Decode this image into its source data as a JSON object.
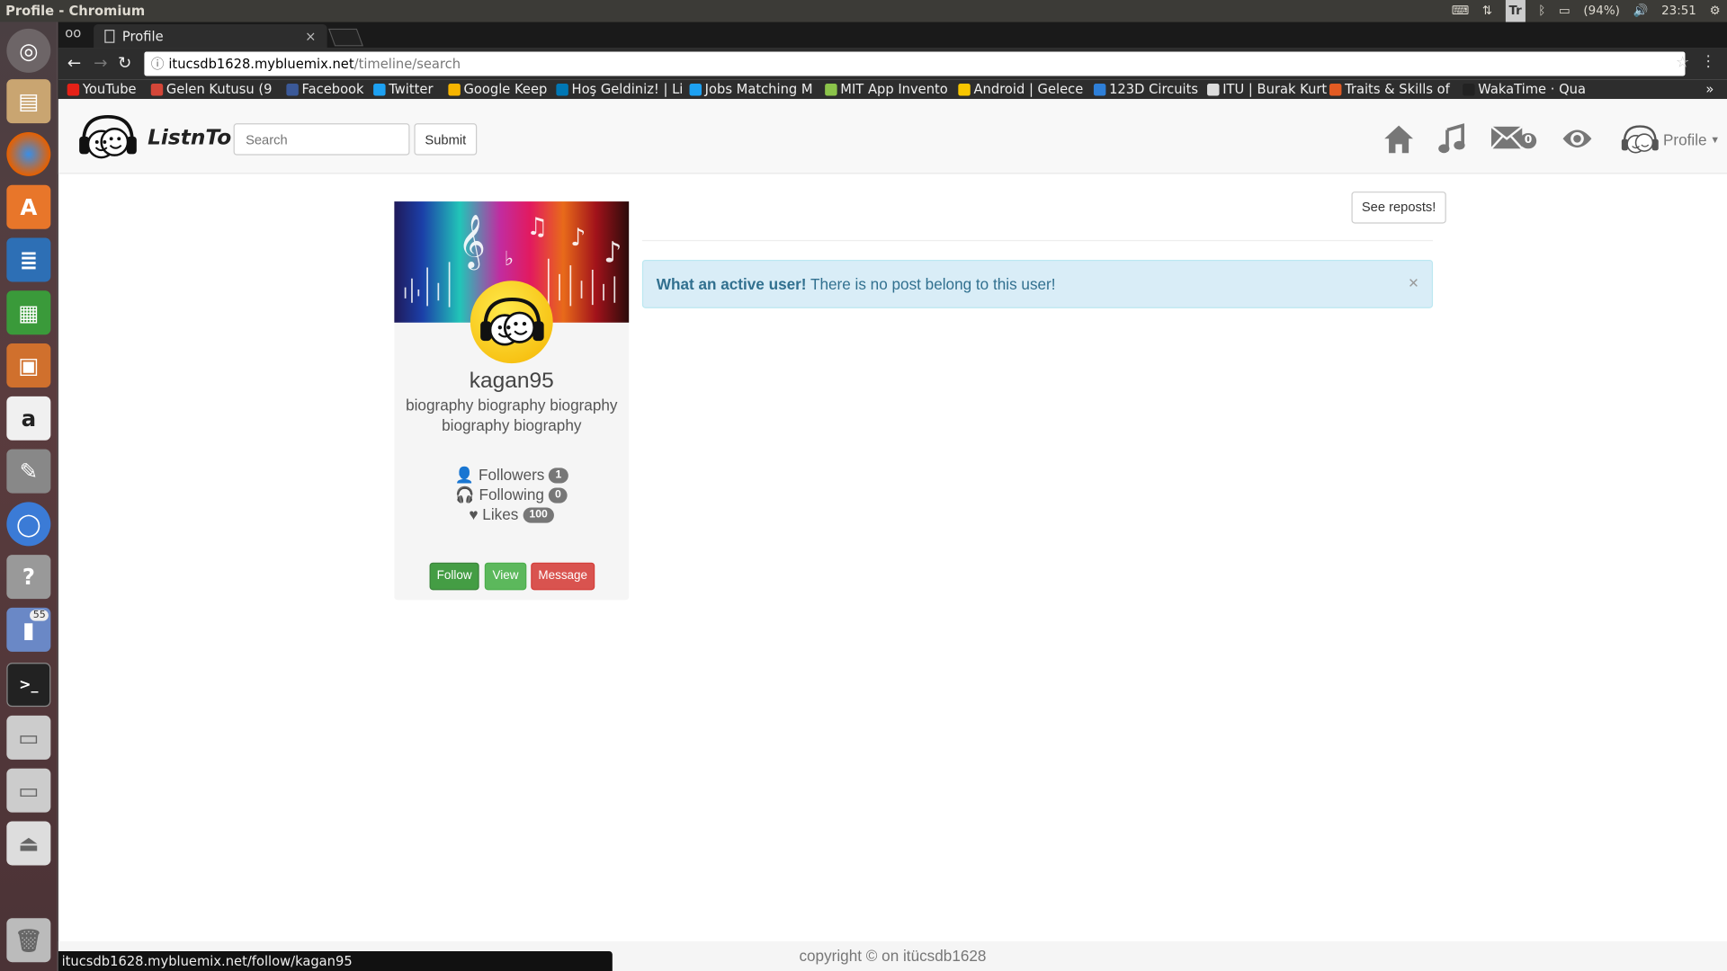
{
  "window_title": "Profile - Chromium",
  "tray": {
    "lang": "Tr",
    "battery": "(94%)",
    "clock": "23:51"
  },
  "tab": {
    "title": "Profile"
  },
  "url": {
    "host": "itucsdb1628.mybluemix.net",
    "path": "/timeline/search"
  },
  "bookmarks": [
    {
      "label": "YouTube",
      "color": "#e62117"
    },
    {
      "label": "Gelen Kutusu (9",
      "color": "#d44638"
    },
    {
      "label": "Facebook",
      "color": "#3b5998"
    },
    {
      "label": "Twitter",
      "color": "#1da1f2"
    },
    {
      "label": "Google Keep",
      "color": "#f7b500"
    },
    {
      "label": "Hoş Geldiniz! | Li",
      "color": "#0077b5"
    },
    {
      "label": "Jobs Matching M",
      "color": "#1da1f2"
    },
    {
      "label": "MIT App Invento",
      "color": "#8bc34a"
    },
    {
      "label": "Android | Gelece",
      "color": "#f7c600"
    },
    {
      "label": "123D Circuits",
      "color": "#2e7fd8"
    },
    {
      "label": "ITU | Burak Kurt",
      "color": "#dddddd"
    },
    {
      "label": "Traits & Skills of",
      "color": "#e25b23"
    },
    {
      "label": "WakaTime · Qua",
      "color": "#222222"
    }
  ],
  "launcher_badge": "55",
  "brand": "ListnTo",
  "search": {
    "placeholder": "Search",
    "submit": "Submit"
  },
  "nav": {
    "messages_count": "0",
    "profile": "Profile"
  },
  "profile": {
    "username": "kagan95",
    "bio": "biography biography biography biography biography",
    "followers_label": "Followers",
    "followers": "1",
    "following_label": "Following",
    "following": "0",
    "likes_label": "Likes",
    "likes": "100",
    "follow": "Follow",
    "view": "View",
    "message": "Message"
  },
  "see_reposts": "See reposts!",
  "alert": {
    "strong": "What an active user!",
    "text": " There is no post belong to this user!"
  },
  "footer": "copyright © on itücsdb1628",
  "status_url": "itucsdb1628.mybluemix.net/follow/kagan95",
  "colors": {
    "follow": "#449d44",
    "view": "#5cb85c",
    "message": "#d9534f",
    "info_bg": "#d9edf7"
  }
}
